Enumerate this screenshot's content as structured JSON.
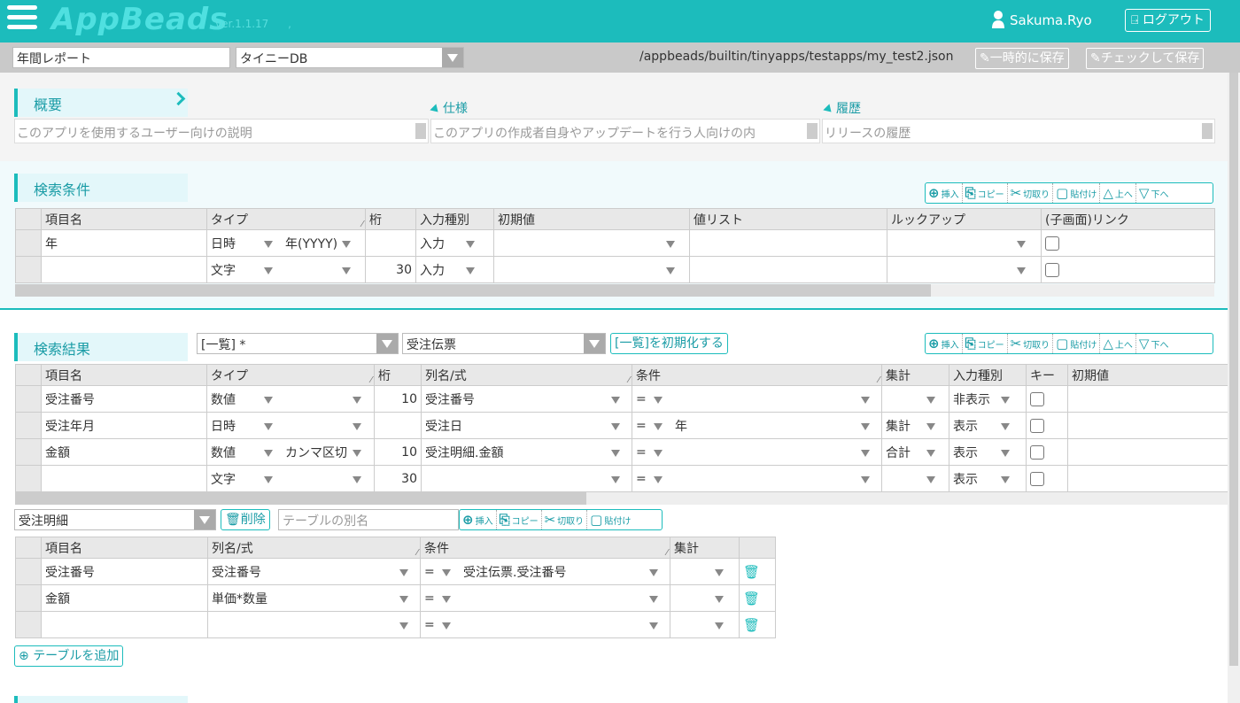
{
  "header": {
    "logo": "AppBeads",
    "version": "ver.1.1.17",
    "version_suffix": ",",
    "user": "Sakuma.Ryo",
    "logout": "ログアウト",
    "accent": "#1cbcbc"
  },
  "toolbar": {
    "app_name": "年間レポート",
    "db": "タイニーDB",
    "path": "/appbeads/builtin/tinyapps/testapps/my_test2.json",
    "save_temp": "一時的に保存",
    "check_save": "チェックして保存"
  },
  "overview": {
    "title": "概要",
    "spec_label": "仕様",
    "history_label": "履歴",
    "desc_placeholder": "このアプリを使用するユーザー向けの説明",
    "spec_placeholder": "このアプリの作成者自身やアップデートを行う人向けの内",
    "history_placeholder": "リリースの履歴"
  },
  "buttons": {
    "insert": "挿入",
    "copy": "コピー",
    "cut": "切取り",
    "paste": "貼付け",
    "up": "上へ",
    "down": "下へ"
  },
  "search": {
    "title": "検索条件",
    "columns": [
      "項目名",
      "タイプ",
      "桁",
      "入力種別",
      "初期値",
      "値リスト",
      "ルックアップ",
      "(子画面)リンク"
    ],
    "rows": [
      {
        "name": "年",
        "type": "日時",
        "format": "年(YYYY)",
        "digits": "",
        "input": "入力"
      },
      {
        "name": "",
        "type": "文字",
        "format": "",
        "digits": "30",
        "input": "入力"
      }
    ]
  },
  "results": {
    "title": "検索結果",
    "list_select": "[一覧] *",
    "table_select": "受注伝票",
    "init_button": "[一覧]を初期化する",
    "columns": [
      "項目名",
      "タイプ",
      "桁",
      "列名/式",
      "条件",
      "集計",
      "入力種別",
      "キー",
      "初期値"
    ],
    "rows": [
      {
        "name": "受注番号",
        "type": "数値",
        "format": "",
        "digits": "10",
        "col": "受注番号",
        "op": "=",
        "cond": "",
        "agg": "",
        "input": "非表示"
      },
      {
        "name": "受注年月",
        "type": "日時",
        "format": "",
        "digits": "",
        "col": "受注日",
        "op": "=",
        "cond": "年",
        "agg": "集計",
        "input": "表示"
      },
      {
        "name": "金額",
        "type": "数値",
        "format": "カンマ区切",
        "digits": "10",
        "col": "受注明細.金額",
        "op": "=",
        "cond": "",
        "agg": "合計",
        "input": "表示"
      },
      {
        "name": "",
        "type": "文字",
        "format": "",
        "digits": "30",
        "col": "",
        "op": "=",
        "cond": "",
        "agg": "",
        "input": "表示"
      }
    ]
  },
  "detail": {
    "table_select": "受注明細",
    "delete": "削除",
    "alias_placeholder": "テーブルの別名",
    "columns": [
      "項目名",
      "列名/式",
      "条件",
      "集計"
    ],
    "rows": [
      {
        "name": "受注番号",
        "col": "受注番号",
        "op": "=",
        "cond": "受注伝票.受注番号"
      },
      {
        "name": "金額",
        "col": "単価*数量",
        "op": "=",
        "cond": ""
      },
      {
        "name": "",
        "col": "",
        "op": "=",
        "cond": ""
      }
    ],
    "add_table": "テーブルを追加"
  }
}
